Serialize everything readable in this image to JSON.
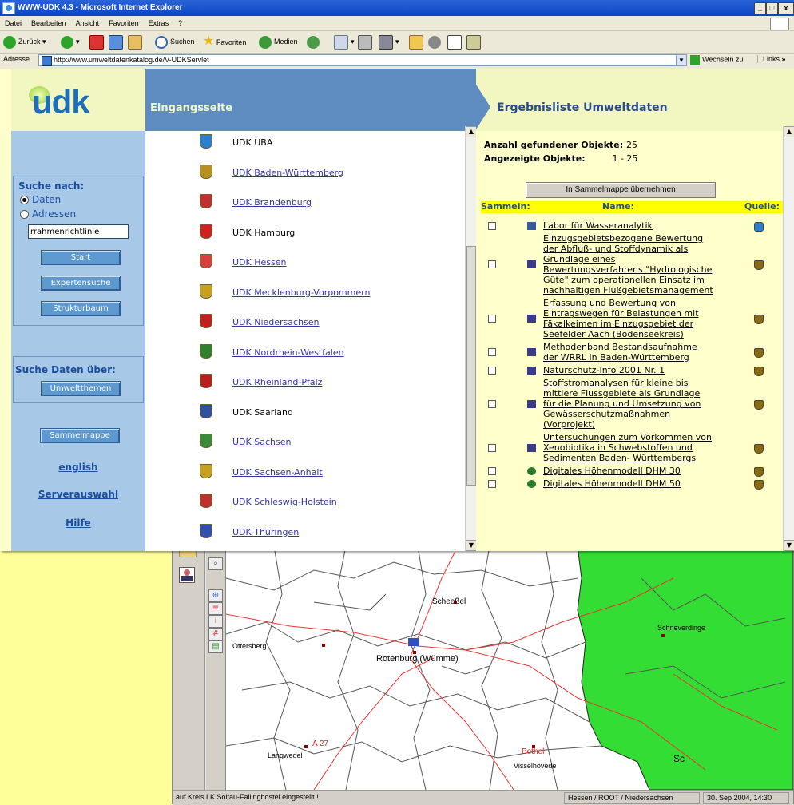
{
  "browser": {
    "title": "WWW-UDK 4.3 - Microsoft Internet Explorer",
    "menu": [
      "Datei",
      "Bearbeiten",
      "Ansicht",
      "Favoriten",
      "Extras",
      "?"
    ],
    "toolbar": {
      "back": "Zurück",
      "search": "Suchen",
      "favorites": "Favoriten",
      "media": "Medien"
    },
    "address_label": "Adresse",
    "address_value": "http://www.umweltdatenkatalog.de/V-UDKServlet",
    "go_label": "Wechseln zu",
    "links_label": "Links",
    "links_more": "»"
  },
  "left_frame": {
    "logo_text": "udk",
    "search_label": "Suche nach:",
    "radio_data": "Daten",
    "radio_addresses": "Adressen",
    "search_value": "rrahmenrichtlinie",
    "start_button": "Start",
    "expert_button": "Expertensuche",
    "tree_button": "Strukturbaum",
    "topics_label": "Suche Daten über:",
    "topics_button": "Umweltthemen",
    "folder_button": "Sammelmappe",
    "link_english": "english",
    "link_server": "Serverauswahl",
    "link_help": "Hilfe"
  },
  "middle_frame": {
    "header": "Eingangsseite",
    "items": [
      {
        "label": "UDK UBA",
        "link": false,
        "color": "#2a7fd0"
      },
      {
        "label": "UDK Baden-Württemberg",
        "link": true,
        "color": "#b89020"
      },
      {
        "label": "UDK Brandenburg",
        "link": true,
        "color": "#c03030"
      },
      {
        "label": "UDK Hamburg",
        "link": false,
        "color": "#d02020"
      },
      {
        "label": "UDK Hessen",
        "link": true,
        "color": "#d84040"
      },
      {
        "label": "UDK Mecklenburg-Vorpommern",
        "link": true,
        "color": "#c8a020"
      },
      {
        "label": "UDK Niedersachsen",
        "link": true,
        "color": "#c02020"
      },
      {
        "label": "UDK Nordrhein-Westfalen",
        "link": true,
        "color": "#308030"
      },
      {
        "label": "UDK Rheinland-Pfalz",
        "link": true,
        "color": "#b82020"
      },
      {
        "label": "UDK Saarland",
        "link": false,
        "color": "#3050a0"
      },
      {
        "label": "UDK Sachsen",
        "link": true,
        "color": "#3a8a3a"
      },
      {
        "label": "UDK Sachsen-Anhalt",
        "link": true,
        "color": "#c8a020"
      },
      {
        "label": "UDK Schleswig-Holstein",
        "link": true,
        "color": "#c03030"
      },
      {
        "label": "UDK Thüringen",
        "link": true,
        "color": "#3050b0"
      }
    ]
  },
  "right_frame": {
    "header": "Ergebnisliste Umweltdaten",
    "found_label": "Anzahl gefundener Objekte:",
    "found_value": "25",
    "shown_label": "Angezeigte Objekte:",
    "shown_value": "1 - 25",
    "collect_button": "In Sammelmappe übernehmen",
    "col_collect": "Sammeln:",
    "col_name": "Name:",
    "col_source": "Quelle:",
    "results": [
      {
        "lines": [
          "Labor für Wasseranalytik"
        ],
        "icon": "dataset-icon"
      },
      {
        "lines": [
          "Einzugsgebietsbezogene Bewertung",
          "der Abfluß- und Stoffdynamik als",
          "Grundlage eines",
          "Bewertungsverfahrens \"Hydrologische",
          "Güte\" zum operationellen Einsatz im",
          "nachhaltigen Flußgebietsmanagement"
        ],
        "icon": "document-icon"
      },
      {
        "lines": [
          "Erfassung und Bewertung von",
          "Eintragswegen für Belastungen mit",
          "Fäkalkeimen im Einzugsgebiet der",
          "Seefelder Aach (Bodenseekreis)"
        ],
        "icon": "document-icon"
      },
      {
        "lines": [
          "Methodenband Bestandsaufnahme",
          "der WRRL in Baden-Württemberg"
        ],
        "icon": "document-icon"
      },
      {
        "lines": [
          "Naturschutz-Info 2001 Nr. 1"
        ],
        "icon": "document-icon"
      },
      {
        "lines": [
          "Stoffstromanalysen für kleine bis",
          "mittlere Flussgebiete als Grundlage",
          "für die Planung und Umsetzung von",
          "Gewässerschutzmaßnahmen",
          "(Vorprojekt)"
        ],
        "icon": "document-icon"
      },
      {
        "lines": [
          "Untersuchungen zum Vorkommen von",
          "Xenobiotika in Schwebstoffen und",
          "Sedimenten Baden- Württembergs"
        ],
        "icon": "document-icon"
      },
      {
        "lines": [
          "Digitales Höhenmodell DHM 30"
        ],
        "icon": "globe-icon"
      },
      {
        "lines": [
          "Digitales Höhenmodell DHM 50"
        ],
        "icon": "globe-icon"
      }
    ]
  },
  "map_window": {
    "labels": [
      "Scheeßel",
      "Rotenburg (Wümme)",
      "Ottersberg",
      "Schneverdinge",
      "Langwedel",
      "Visselhövede",
      "A 27",
      "Bothel",
      "Sc"
    ],
    "status_left": "auf Kreis LK Soltau-Fallingbostel eingestellt !",
    "status_mid": "Hessen / ROOT / Niedersachsen",
    "status_right": "30. Sep 2004, 14:30"
  }
}
